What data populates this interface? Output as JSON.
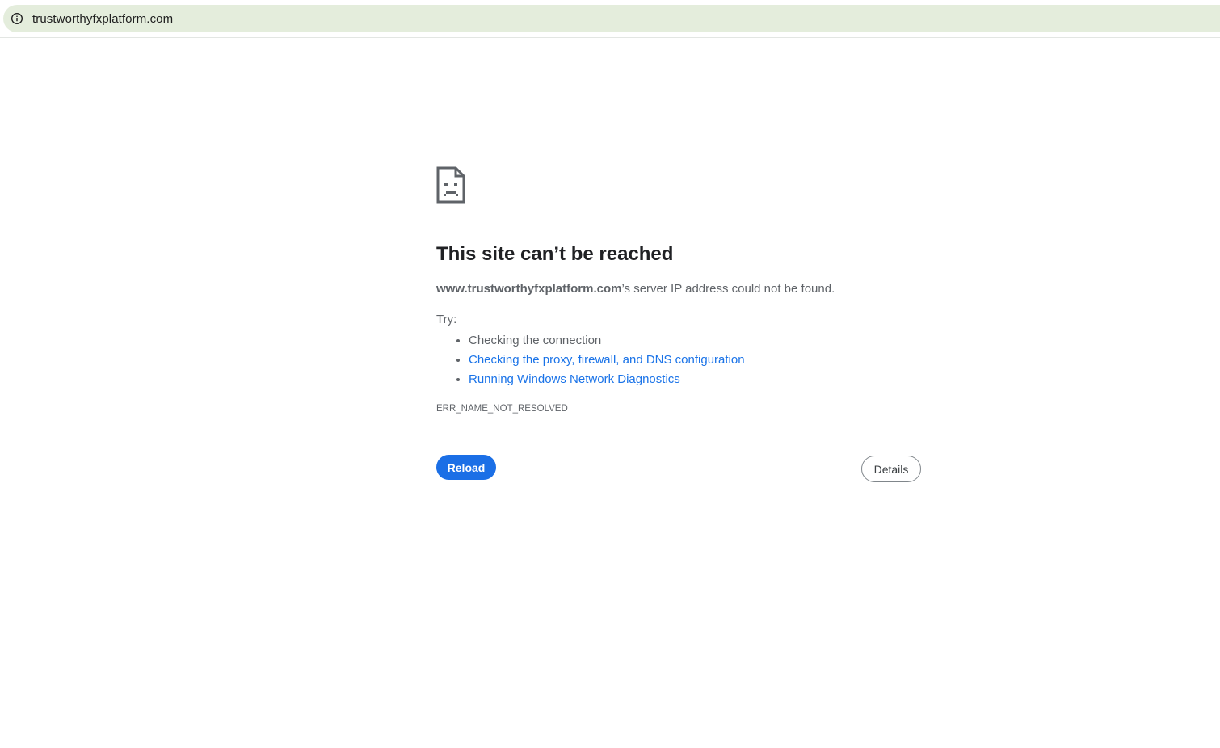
{
  "browser": {
    "url": "trustworthyfxplatform.com",
    "info_icon": "info-icon"
  },
  "error_page": {
    "icon": "sad-page-icon",
    "title": "This site can’t be reached",
    "host": "www.trustworthyfxplatform.com",
    "message_suffix": "’s server IP address could not be found.",
    "try_label": "Try:",
    "suggestions": [
      "Checking the connection",
      "Checking the proxy, firewall, and DNS configuration",
      "Running Windows Network Diagnostics"
    ],
    "error_code": "ERR_NAME_NOT_RESOLVED",
    "reload_label": "Reload",
    "details_label": "Details"
  },
  "colors": {
    "omnibox_bg": "#e4eddc",
    "link": "#1a73e8",
    "primary_button": "#1b6fe6",
    "secondary_text": "#5f6368"
  }
}
